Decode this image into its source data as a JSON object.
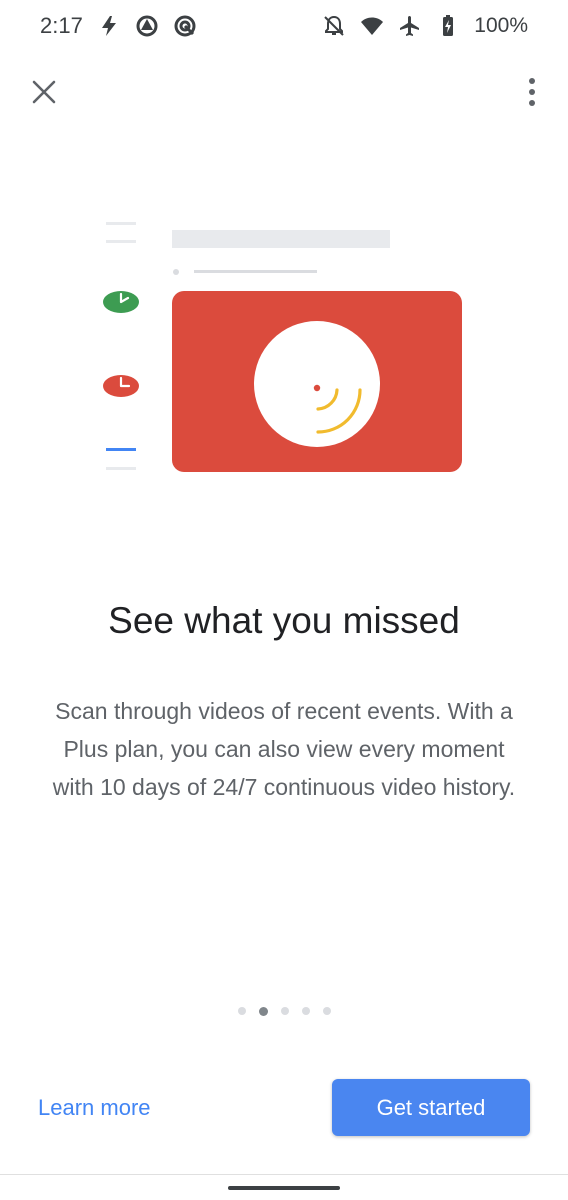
{
  "status_bar": {
    "time": "2:17",
    "battery": "100%",
    "left_icons": [
      "flash-icon",
      "app-notification-icon",
      "app-notification-icon-2"
    ],
    "right_icons": [
      "notifications-off-icon",
      "wifi-icon",
      "airplane-mode-icon",
      "battery-icon"
    ]
  },
  "topbar": {
    "close_icon": "close-icon",
    "more_icon": "more-vert-icon"
  },
  "onboarding": {
    "title": "See what you missed",
    "description": "Scan through videos of recent events. With a Plus plan, you can also view every moment with 10 days of 24/7 continuous video history.",
    "page_count": 5,
    "current_page": 2
  },
  "actions": {
    "learn_more": "Learn more",
    "get_started": "Get started"
  },
  "colors": {
    "accent_blue": "#4a86f0",
    "link_blue": "#4285f4",
    "card_red": "#db4b3d",
    "green": "#3d9c52",
    "yellow": "#f1bb2e"
  }
}
